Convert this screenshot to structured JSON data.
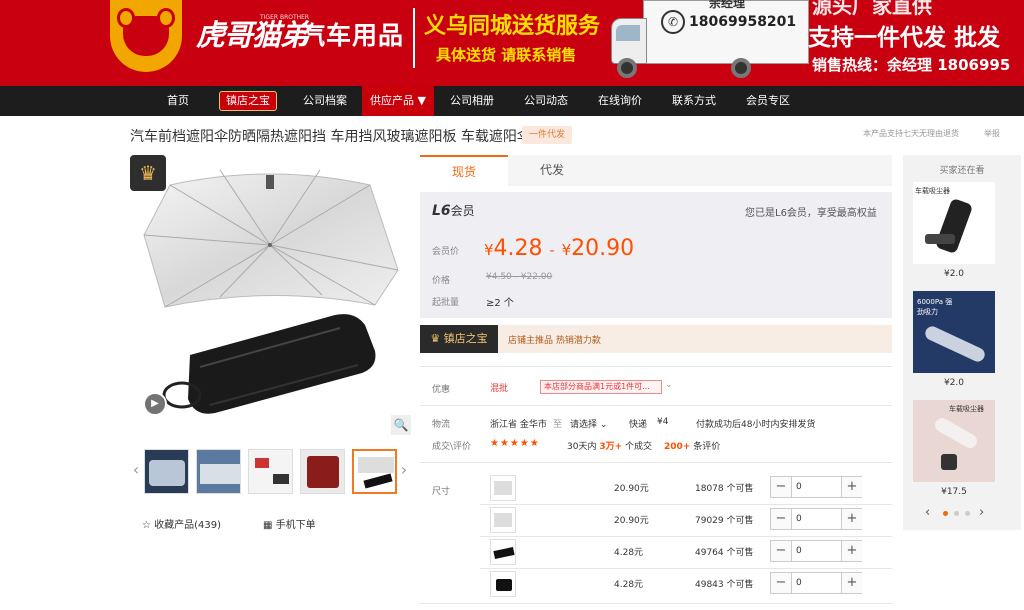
{
  "banner": {
    "brand_script": "虎哥猫弟",
    "brand_sub": "TIGER BROTHER",
    "brand_title": "汽车用品",
    "service_main": "义乌同城送货服务",
    "service_sub": "具体送货 请联系销售",
    "truck_name": "余经理",
    "truck_phone": "18069958201",
    "slogan_top": "源头厂家直供",
    "slogan": "支持一件代发 批发",
    "hotline": "销售热线：余经理 1806995"
  },
  "nav": {
    "items": [
      "首页",
      "镇店之宝",
      "公司档案",
      "供应产品 ▼",
      "公司相册",
      "公司动态",
      "在线询价",
      "联系方式",
      "会员专区"
    ]
  },
  "product": {
    "title": "汽车前档遮阳伞防晒隔热遮阳挡 车用挡风玻璃遮阳板 车载遮阳伞",
    "dropship_tag": "一件代发",
    "return_note": "本产品支持七天无理由退货",
    "report": "举报"
  },
  "gallery": {
    "favorite": "收藏产品(439)",
    "mobile_order": "手机下单",
    "crown_icon": "crown-icon",
    "play_icon": "play-icon",
    "zoom_icon": "zoom-icon"
  },
  "tabs": [
    "现货",
    "代发"
  ],
  "pricing": {
    "level": "L6",
    "level_suffix": "会员",
    "member_note": "您已是L6会员，享受最高权益",
    "member_price_label": "会员价",
    "price_low": "4.28",
    "price_high": "20.90",
    "currency": "¥",
    "dash": "-",
    "price_label": "价格",
    "old_price": "¥4.50 - ¥22.00",
    "moq_label": "起批量",
    "moq": "≥2 个"
  },
  "store": {
    "badge": "镇店之宝",
    "strip_text": "店铺主推品  热销潜力款"
  },
  "offers": {
    "promo_label": "优惠",
    "promo_tag": "混批",
    "promo_box": "本店部分商品满1元或1件可...",
    "logistics_label": "物流",
    "origin": "浙江省 金华市",
    "to": "至",
    "dest": "请选择",
    "express": "快递",
    "fee": "¥4",
    "ship_note": "付款成功后48小时内安排发货",
    "reviews_label": "成交\\评价",
    "stars": "★★★★★",
    "deals_prefix": "30天内",
    "deals_count": "3万+",
    "deals_suffix": "个成交",
    "review_count": "200+",
    "review_suffix": "条评价"
  },
  "sku": {
    "label": "尺寸",
    "rows": [
      {
        "price": "20.90元",
        "stock": "18078 个可售",
        "qty": "0"
      },
      {
        "price": "20.90元",
        "stock": "79029 个可售",
        "qty": "0"
      },
      {
        "price": "4.28元",
        "stock": "49764 个可售",
        "qty": "0"
      },
      {
        "price": "4.28元",
        "stock": "49843 个可售",
        "qty": "0"
      }
    ],
    "minus": "−",
    "plus": "+"
  },
  "rail": {
    "title": "买家还在看",
    "items": [
      {
        "price": "¥2.0",
        "caption": "车载吸尘器"
      },
      {
        "price": "¥2.0",
        "caption": "6000Pa 强劲吸力"
      },
      {
        "price": "¥17.5",
        "caption": "车载吸尘器"
      }
    ]
  },
  "colors": {
    "brand_red": "#c90010",
    "accent_orange": "#ff5000",
    "nav_black": "#1d1d1d"
  }
}
